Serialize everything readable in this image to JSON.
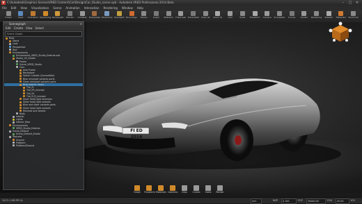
{
  "titlebar": {
    "app_icon": "V",
    "title": "C:\\Autodesk\\Graphics Scenes\\VRED Content\\Car\\Design\\Car_Studio_scene.vpb - Autodesk VRED Professional 2014 Beta",
    "minimize": "–",
    "maximize": "□",
    "close": "✕"
  },
  "menu": [
    "File",
    "Edit",
    "View",
    "Visualization",
    "Scene",
    "Animation",
    "Interaction",
    "Rendering",
    "Window",
    "Help"
  ],
  "toolbar": [
    {
      "label": "Graph",
      "color": "#8a8a8a"
    },
    {
      "label": "Save",
      "color": "#5a8ac0"
    },
    {
      "label": "Animation",
      "color": "#c07a30"
    },
    {
      "label": "Raytracing",
      "color": "#d08a2a"
    },
    {
      "label": "Renderpath",
      "color": "#d09a3a"
    },
    {
      "label": "Render",
      "color": "#7a7a7a"
    },
    {
      "label": "Antialias",
      "color": "#9a9a9a"
    },
    {
      "label": "Backplates",
      "color": "#a06a40"
    },
    {
      "label": "Wireframe",
      "color": "#7a9ac0"
    },
    {
      "label": "Headlight",
      "color": "#c0a040"
    },
    {
      "label": "Boundings",
      "color": "#d06a30"
    },
    {
      "label": "Stereo",
      "color": "#8a8a8a"
    },
    {
      "label": "Graph",
      "color": "#7a7a7a"
    },
    {
      "label": "Statistics",
      "color": "#8a8a8a"
    },
    {
      "label": "Fullscreen",
      "color": "#9a9a9a"
    },
    {
      "label": "Presentation",
      "color": "#7a7a7a"
    },
    {
      "label": "Clear all",
      "color": "#8a8a8a"
    },
    {
      "label": "Zoom To",
      "color": "#aaaaaa"
    },
    {
      "label": "Grid",
      "color": "#9a9a9a"
    },
    {
      "label": "Scale",
      "color": "#8a8a8a"
    },
    {
      "label": "Transform",
      "color": "#aaaaaa"
    },
    {
      "label": "Camera",
      "color": "#9a9a9a"
    },
    {
      "label": "Sceneplate",
      "color": "#8a8a8a"
    },
    {
      "label": "Curves",
      "color": "#7a7a7a"
    },
    {
      "label": "Cluster",
      "color": "#9a9a9a"
    },
    {
      "label": "Rendering",
      "color": "#8a8a8a"
    },
    {
      "label": "Sidebar",
      "color": "#aaaaaa"
    },
    {
      "label": "Materials",
      "color": "#d07a30"
    },
    {
      "label": "Shortcuts",
      "color": "#8a8a8a"
    }
  ],
  "scenegraph": {
    "title": "Scenegraph",
    "menu": [
      "Edit",
      "Create",
      "View",
      "Select"
    ],
    "filter_placeholder": "Scene Graph",
    "rows": [
      {
        "label": "Root",
        "depth": 0,
        "color": "#d08a2a"
      },
      {
        "label": "Stand",
        "depth": 1,
        "color": "#d08a2a"
      },
      {
        "label": "Lods",
        "depth": 1,
        "color": "#b0b0b0"
      },
      {
        "label": "Perspective",
        "depth": 1,
        "color": "#5a9ad0"
      },
      {
        "label": "Test",
        "depth": 1,
        "color": "#b0b0b0"
      },
      {
        "label": "Environments",
        "depth": 1,
        "color": "#d08a2a"
      },
      {
        "label": "Environment_VRED_Studio_Exterior.osb",
        "depth": 2,
        "color": "#5aa05a"
      },
      {
        "label": "Studio_V2_Studio",
        "depth": 2,
        "color": "#d08a2a"
      },
      {
        "label": "Frame",
        "depth": 3,
        "color": "#b0b0b0"
      },
      {
        "label": "Scene_VRED_Studio",
        "depth": 3,
        "color": "#5aa05a"
      },
      {
        "label": "Cars",
        "depth": 3,
        "color": "#b0b0b0"
      },
      {
        "label": "Axle Frame",
        "depth": 4,
        "color": "#d08a2a"
      },
      {
        "label": "Backplane",
        "depth": 4,
        "color": "#d08a2a"
      },
      {
        "label": "Switch Cockpit (Convertible)",
        "depth": 4,
        "color": "#d08a2a"
      },
      {
        "label": "Blue rims/roof variants parts",
        "depth": 4,
        "color": "#d08a2a"
      },
      {
        "label": "Silver rims/roof variants parts",
        "depth": 4,
        "color": "#d08a2a"
      },
      {
        "label": "Blue interior (dark)",
        "depth": 4,
        "color": "#d08a2a"
      },
      {
        "label": "Tire_FL",
        "depth": 5,
        "color": "#d08a2a"
      },
      {
        "label": "Tire_FR_rimmed",
        "depth": 5,
        "color": "#d08a2a"
      },
      {
        "label": "Tire_RL",
        "depth": 5,
        "color": "#d08a2a"
      },
      {
        "label": "Tire_R_R_rimmed",
        "depth": 5,
        "color": "#d08a2a"
      },
      {
        "label": "Silver head light reversion",
        "depth": 4,
        "color": "#d08a2a"
      },
      {
        "label": "Silver head light variants",
        "depth": 4,
        "color": "#d08a2a"
      },
      {
        "label": "Blue and silver variants parts",
        "depth": 4,
        "color": "#d08a2a"
      },
      {
        "label": "Silver head light variants",
        "depth": 4,
        "color": "#d08a2a"
      },
      {
        "label": "Rimmed and wheels",
        "depth": 4,
        "color": "#d08a2a"
      },
      {
        "label": "Body",
        "depth": 3,
        "color": "#b0b0b0"
      },
      {
        "label": "Interior",
        "depth": 2,
        "color": "#b0b0b0"
      },
      {
        "label": "Lights",
        "depth": 2,
        "color": "#d0c030"
      },
      {
        "label": "Interior_Rear",
        "depth": 2,
        "color": "#b0b0b0"
      },
      {
        "label": "Environments",
        "depth": 1,
        "color": "#d08a2a"
      },
      {
        "label": "VRED_Studio_Exterior",
        "depth": 2,
        "color": "#5aa05a"
      },
      {
        "label": "Scene_Default",
        "depth": 1,
        "color": "#b0b0b0"
      },
      {
        "label": "Scene_Default_Studio",
        "depth": 2,
        "color": "#5aa05a"
      },
      {
        "label": "Textures",
        "depth": 1,
        "color": "#b0b0b0"
      },
      {
        "label": "Ground",
        "depth": 2,
        "color": "#d08a2a"
      },
      {
        "label": "Platform",
        "depth": 2,
        "color": "#b0b0b0"
      },
      {
        "label": "Platform/Ground",
        "depth": 2,
        "color": "#b0b0b0"
      }
    ]
  },
  "car": {
    "plate": "FI ED 2016"
  },
  "bottom_toolbar": [
    {
      "label": "Graph",
      "color": "#d08a2a"
    },
    {
      "label": "Transform",
      "color": "#d08a2a"
    },
    {
      "label": "Materials",
      "color": "#d08a2a"
    },
    {
      "label": "Cameras",
      "color": "#d08a2a"
    },
    {
      "label": "Clips",
      "color": "#9a9a9a"
    },
    {
      "label": "Curves",
      "color": "#9a9a9a"
    },
    {
      "label": "Vsets",
      "color": "#9a9a9a"
    },
    {
      "label": "Render",
      "color": "#9a9a9a"
    }
  ],
  "status": {
    "memory": "3423.1 MB  PR  GL",
    "units": "mm",
    "ncp": "NCP",
    "ncp_value": "0.100",
    "fcp": "FCP",
    "fcp_value": "50000.00",
    "fov": "FOV",
    "fov_value": "45.00",
    "icv": "ICV"
  },
  "colors": {
    "accent": "#d08a2a",
    "selection": "#2f6fa0"
  }
}
